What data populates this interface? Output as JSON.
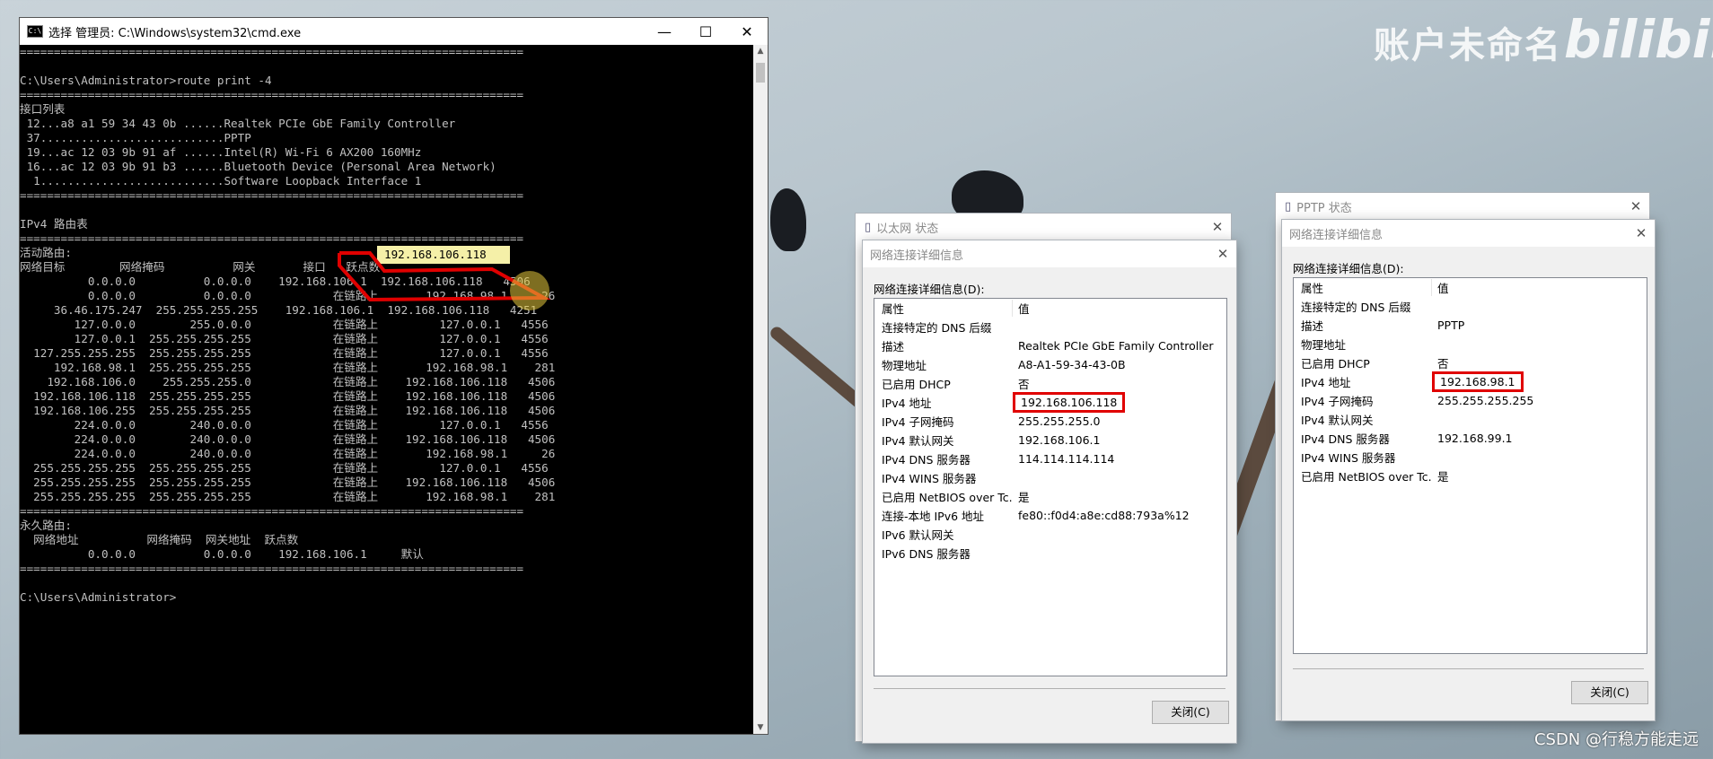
{
  "desktop": {
    "watermark": "账户未命名",
    "bilibili_logo": "bilibili",
    "csdn_watermark": "CSDN @行稳方能走远"
  },
  "cmd": {
    "title": "选择 管理员: C:\\Windows\\system32\\cmd.exe",
    "minimize": "—",
    "maximize": "☐",
    "close": "✕",
    "highlight": "192.168.106.118",
    "lines": [
      "==========================================================================",
      "",
      "C:\\Users\\Administrator>route print -4",
      "==========================================================================",
      "接口列表",
      " 12...a8 a1 59 34 43 0b ......Realtek PCIe GbE Family Controller",
      " 37...........................PPTP",
      " 19...ac 12 03 9b 91 af ......Intel(R) Wi-Fi 6 AX200 160MHz",
      " 16...ac 12 03 9b 91 b3 ......Bluetooth Device (Personal Area Network)",
      "  1...........................Software Loopback Interface 1",
      "==========================================================================",
      "",
      "IPv4 路由表",
      "==========================================================================",
      "活动路由:",
      "网络目标        网络掩码          网关       接口   跃点数",
      "          0.0.0.0          0.0.0.0    192.168.106.1  192.168.106.118   4506",
      "          0.0.0.0          0.0.0.0            在链路上       192.168.98.1     26",
      "     36.46.175.247  255.255.255.255    192.168.106.1  192.168.106.118   4251",
      "        127.0.0.0        255.0.0.0            在链路上         127.0.0.1   4556",
      "        127.0.0.1  255.255.255.255            在链路上         127.0.0.1   4556",
      "  127.255.255.255  255.255.255.255            在链路上         127.0.0.1   4556",
      "     192.168.98.1  255.255.255.255            在链路上       192.168.98.1    281",
      "    192.168.106.0    255.255.255.0            在链路上    192.168.106.118   4506",
      "  192.168.106.118  255.255.255.255            在链路上    192.168.106.118   4506",
      "  192.168.106.255  255.255.255.255            在链路上    192.168.106.118   4506",
      "        224.0.0.0        240.0.0.0            在链路上         127.0.0.1   4556",
      "        224.0.0.0        240.0.0.0            在链路上    192.168.106.118   4506",
      "        224.0.0.0        240.0.0.0            在链路上       192.168.98.1     26",
      "  255.255.255.255  255.255.255.255            在链路上         127.0.0.1   4556",
      "  255.255.255.255  255.255.255.255            在链路上    192.168.106.118   4506",
      "  255.255.255.255  255.255.255.255            在链路上       192.168.98.1    281",
      "==========================================================================",
      "永久路由:",
      "  网络地址          网络掩码  网关地址  跃点数",
      "          0.0.0.0          0.0.0.0    192.168.106.1     默认",
      "==========================================================================",
      "",
      "C:\\Users\\Administrator>"
    ]
  },
  "eth_status": {
    "title": "以太网 状态",
    "close": "✕"
  },
  "eth_details": {
    "title": "网络连接详细信息",
    "label": "网络连接详细信息(D):",
    "col_property": "属性",
    "col_value": "值",
    "rows": [
      {
        "k": "连接特定的 DNS 后缀",
        "v": ""
      },
      {
        "k": "描述",
        "v": "Realtek PCIe GbE Family Controller"
      },
      {
        "k": "物理地址",
        "v": "A8-A1-59-34-43-0B"
      },
      {
        "k": "已启用 DHCP",
        "v": "否"
      },
      {
        "k": "IPv4 地址",
        "v": "192.168.106.118"
      },
      {
        "k": "IPv4 子网掩码",
        "v": "255.255.255.0"
      },
      {
        "k": "IPv4 默认网关",
        "v": "192.168.106.1"
      },
      {
        "k": "IPv4 DNS 服务器",
        "v": "114.114.114.114"
      },
      {
        "k": "IPv4 WINS 服务器",
        "v": ""
      },
      {
        "k": "已启用 NetBIOS over Tc...",
        "v": "是"
      },
      {
        "k": "连接-本地 IPv6 地址",
        "v": "fe80::f0d4:a8e:cd88:793a%12"
      },
      {
        "k": "IPv6 默认网关",
        "v": ""
      },
      {
        "k": "IPv6 DNS 服务器",
        "v": ""
      }
    ],
    "close_button": "关闭(C)",
    "close": "✕"
  },
  "pptp_status": {
    "title": "PPTP 状态",
    "close": "✕"
  },
  "pptp_details": {
    "title": "网络连接详细信息",
    "label": "网络连接详细信息(D):",
    "col_property": "属性",
    "col_value": "值",
    "rows": [
      {
        "k": "连接特定的 DNS 后缀",
        "v": ""
      },
      {
        "k": "描述",
        "v": "PPTP"
      },
      {
        "k": "物理地址",
        "v": ""
      },
      {
        "k": "已启用 DHCP",
        "v": "否"
      },
      {
        "k": "IPv4 地址",
        "v": "192.168.98.1"
      },
      {
        "k": "IPv4 子网掩码",
        "v": "255.255.255.255"
      },
      {
        "k": "IPv4 默认网关",
        "v": ""
      },
      {
        "k": "IPv4 DNS 服务器",
        "v": "192.168.99.1"
      },
      {
        "k": "IPv4 WINS 服务器",
        "v": ""
      },
      {
        "k": "已启用 NetBIOS over Tc...",
        "v": "是"
      }
    ],
    "close_button": "关闭(C)",
    "close": "✕"
  },
  "colors": {
    "annotation_red": "#e00000",
    "selection_yellow": "#f5f0a8"
  }
}
